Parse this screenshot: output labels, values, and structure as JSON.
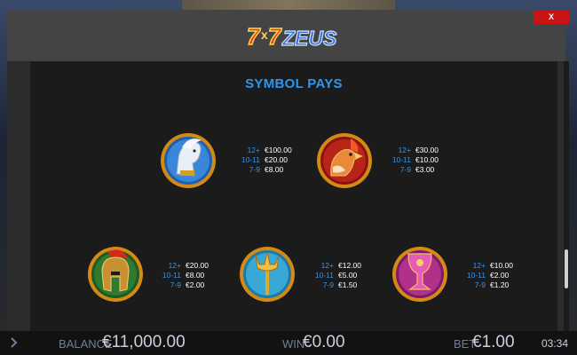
{
  "modal": {
    "close_label": "X",
    "logo_text": "7x7 ZEUS",
    "section_title": "SYMBOL PAYS"
  },
  "symbols": [
    {
      "name": "pegasus",
      "pays": [
        {
          "count": "12+",
          "value": "€100.00"
        },
        {
          "count": "10-11",
          "value": "€20.00"
        },
        {
          "count": "7-9",
          "value": "€8.00"
        }
      ]
    },
    {
      "name": "eagle",
      "pays": [
        {
          "count": "12+",
          "value": "€30.00"
        },
        {
          "count": "10-11",
          "value": "€10.00"
        },
        {
          "count": "7-9",
          "value": "€3.00"
        }
      ]
    },
    {
      "name": "helmet",
      "pays": [
        {
          "count": "12+",
          "value": "€20.00"
        },
        {
          "count": "10-11",
          "value": "€8.00"
        },
        {
          "count": "7-9",
          "value": "€2.00"
        }
      ]
    },
    {
      "name": "trident",
      "pays": [
        {
          "count": "12+",
          "value": "€12.00"
        },
        {
          "count": "10-11",
          "value": "€5.00"
        },
        {
          "count": "7-9",
          "value": "€1.50"
        }
      ]
    },
    {
      "name": "chalice",
      "pays": [
        {
          "count": "12+",
          "value": "€10.00"
        },
        {
          "count": "10-11",
          "value": "€2.00"
        },
        {
          "count": "7-9",
          "value": "€1.20"
        }
      ]
    }
  ],
  "bottom_bar": {
    "balance_label": "BALANCE",
    "balance_value": "€11,000.00",
    "win_label": "WIN",
    "win_value": "€0.00",
    "bet_label": "BET",
    "bet_value": "€1.00",
    "clock": "03:34"
  },
  "colors": {
    "accent": "#2f96f0",
    "close": "#c81414",
    "gold": "#d4a020"
  }
}
